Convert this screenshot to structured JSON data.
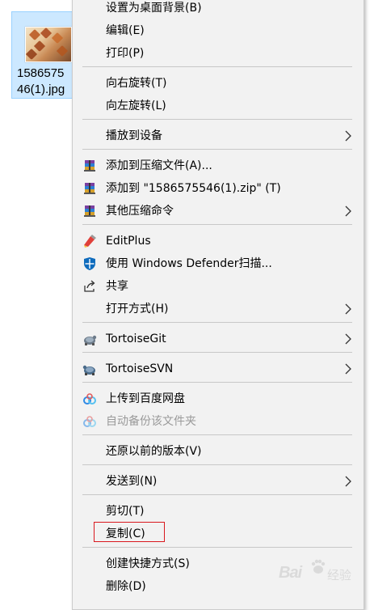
{
  "file": {
    "name_line1": "1586575",
    "name_line2": "46(1).jpg"
  },
  "menu": {
    "items": {
      "set_wallpaper": "设置为桌面背景(B)",
      "edit": "编辑(E)",
      "print": "打印(P)",
      "rotate_right": "向右旋转(T)",
      "rotate_left": "向左旋转(L)",
      "cast": "播放到设备",
      "add_archive": "添加到压缩文件(A)...",
      "add_zip": "添加到 \"1586575546(1).zip\" (T)",
      "other_compress": "其他压缩命令",
      "editplus": "EditPlus",
      "defender": "使用 Windows Defender扫描...",
      "share": "共享",
      "open_with": "打开方式(H)",
      "tortoisegit": "TortoiseGit",
      "tortoisesvn": "TortoiseSVN",
      "baidu_upload": "上传到百度网盘",
      "baidu_backup": "自动备份该文件夹",
      "restore": "还原以前的版本(V)",
      "send_to": "发送到(N)",
      "cut": "剪切(T)",
      "copy": "复制(C)",
      "shortcut": "创建快捷方式(S)",
      "delete": "删除(D)"
    },
    "icons": {
      "winrar": "winrar-archive-icon",
      "editplus": "editplus-icon",
      "defender": "windows-defender-shield-icon",
      "share": "share-icon",
      "tortoisegit": "tortoisegit-icon",
      "tortoisesvn": "tortoisesvn-icon",
      "baidu": "baidu-netdisk-icon"
    }
  },
  "colors": {
    "menu_bg": "#f2f2f2",
    "selection_bg": "#cce8ff",
    "highlight_border": "#d9181e",
    "disabled_text": "#9a9a9a"
  },
  "watermark": {
    "latin": "Bai",
    "cn": "经验"
  }
}
